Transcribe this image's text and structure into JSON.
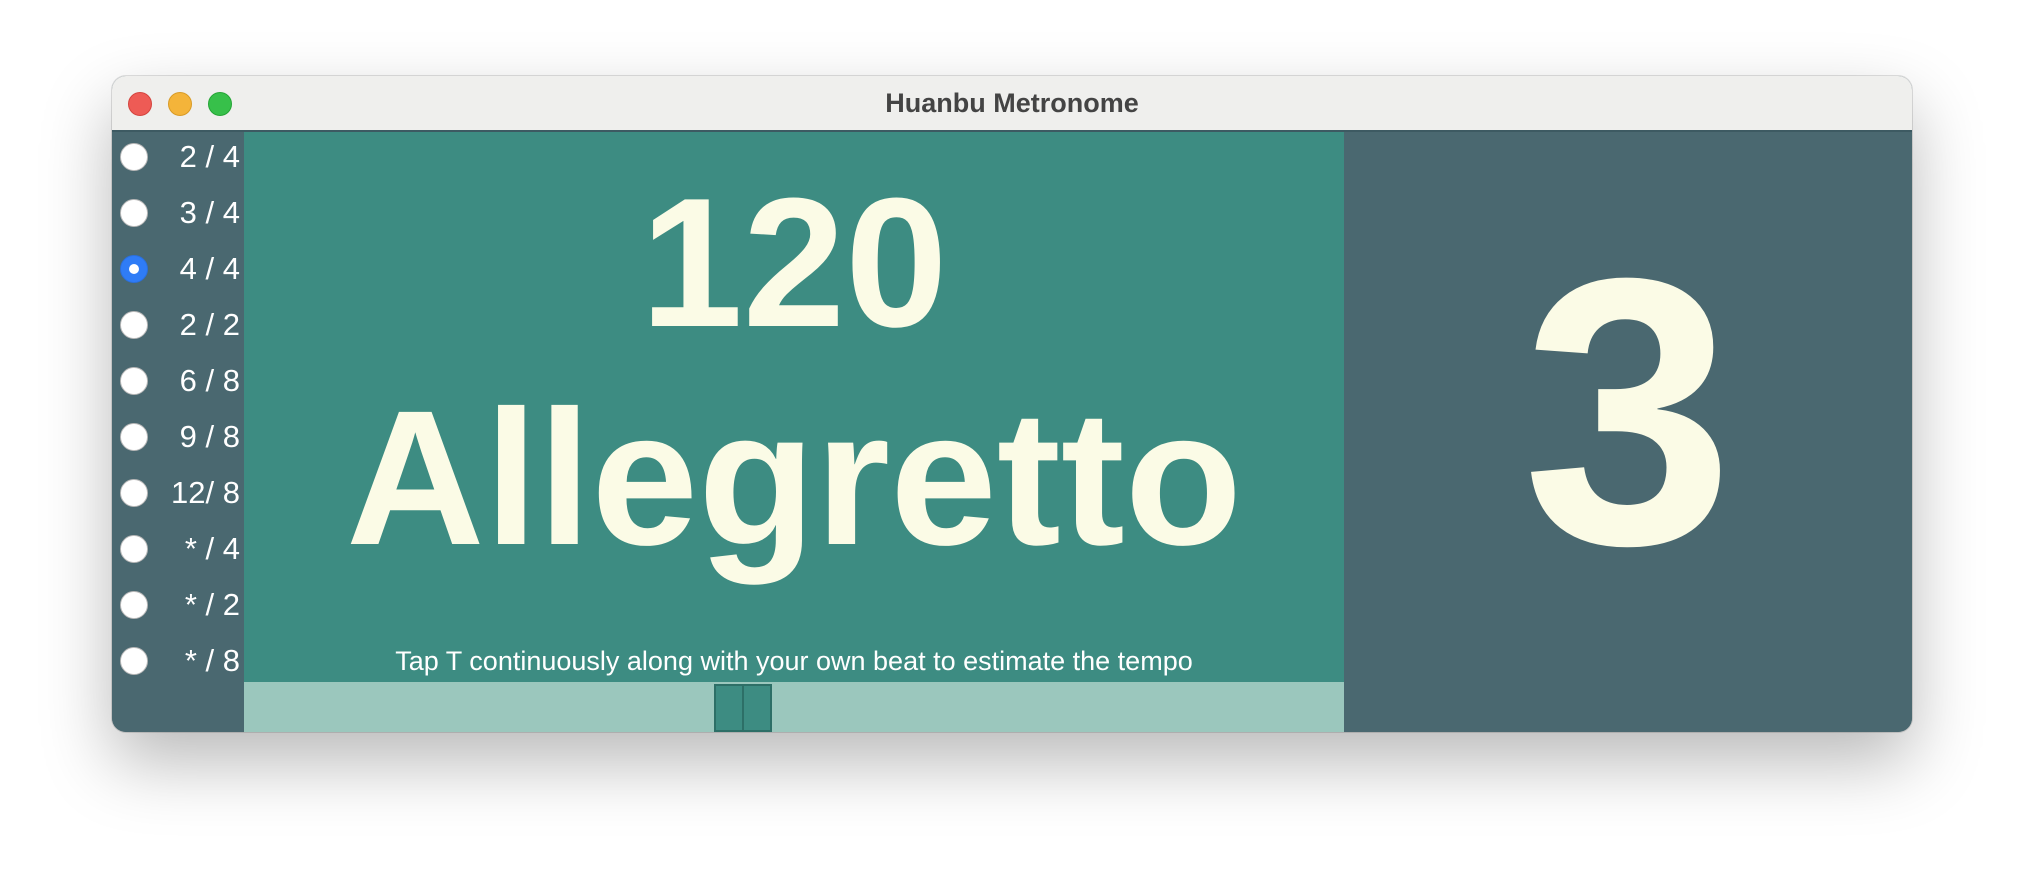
{
  "window": {
    "title": "Huanbu Metronome"
  },
  "time_signatures": {
    "selected": "4 / 4",
    "options": [
      {
        "label": "2 / 4",
        "checked": false
      },
      {
        "label": "3 / 4",
        "checked": false
      },
      {
        "label": "4 / 4",
        "checked": true
      },
      {
        "label": "2 / 2",
        "checked": false
      },
      {
        "label": "6 / 8",
        "checked": false
      },
      {
        "label": "9 / 8",
        "checked": false
      },
      {
        "label": "12/ 8",
        "checked": false
      },
      {
        "label": "* / 4",
        "checked": false
      },
      {
        "label": "* / 2",
        "checked": false
      },
      {
        "label": "* / 8",
        "checked": false
      }
    ]
  },
  "tempo": {
    "bpm": "120",
    "name": "Allegretto",
    "tap_hint": "Tap T continuously along with your own beat to estimate the tempo"
  },
  "beat": {
    "current": "3"
  },
  "colors": {
    "main_panel": "#3d8c82",
    "side_panels": "#4a6870",
    "slider_track": "#9bc7bd",
    "text_cream": "#fbfbe6",
    "radio_selected": "#2f7cf6"
  }
}
